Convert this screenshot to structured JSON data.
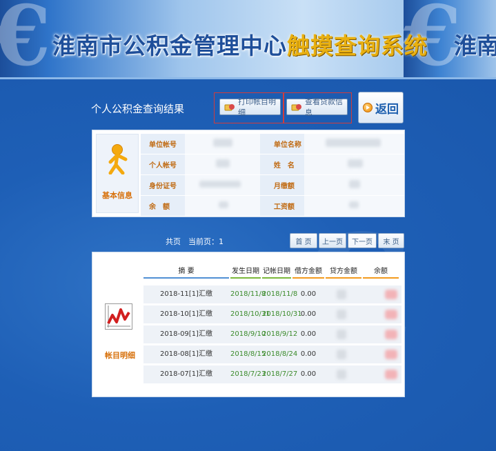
{
  "banner": {
    "title_part1": "淮南市公积金管理中心",
    "title_part2": "触摸查询系统",
    "title_repeat": "淮南市"
  },
  "toolbar": {
    "section_title": "个人公积金查询结果",
    "print_label": "打印帐目明细",
    "loan_label": "查看贷款信息",
    "back_label": "返回"
  },
  "info": {
    "side_label": "基本信息",
    "rows": [
      {
        "left_label": "单位帐号",
        "right_label": "单位名称"
      },
      {
        "left_label": "个人帐号",
        "right_label": "姓　名"
      },
      {
        "left_label": "身份证号",
        "right_label": "月缴额"
      },
      {
        "left_label": "余　额",
        "right_label": "工资额"
      }
    ]
  },
  "pager": {
    "text": "共页　当前页：1",
    "first": "首 页",
    "prev": "上一页",
    "next": "下一页",
    "last": "末 页"
  },
  "detail": {
    "side_label": "帐目明细",
    "headers": [
      "摘 要",
      "发生日期",
      "记帐日期",
      "借方金额",
      "贷方金额",
      "余额"
    ],
    "rows": [
      {
        "summary": "2018-11[1]汇缴",
        "occur": "2018/11/8",
        "post": "2018/11/8",
        "debit": "0.00"
      },
      {
        "summary": "2018-10[1]汇缴",
        "occur": "2018/10/31",
        "post": "2018/10/31",
        "debit": "0.00"
      },
      {
        "summary": "2018-09[1]汇缴",
        "occur": "2018/9/10",
        "post": "2018/9/12",
        "debit": "0.00"
      },
      {
        "summary": "2018-08[1]汇缴",
        "occur": "2018/8/15",
        "post": "2018/8/24",
        "debit": "0.00"
      },
      {
        "summary": "2018-07[1]汇缴",
        "occur": "2018/7/23",
        "post": "2018/7/27",
        "debit": "0.00"
      }
    ]
  },
  "colors": {
    "accent": "#1f5fb8",
    "label_orange": "#c06a12",
    "date_green": "#3a8a2a",
    "outline_red": "#d23c3c"
  }
}
